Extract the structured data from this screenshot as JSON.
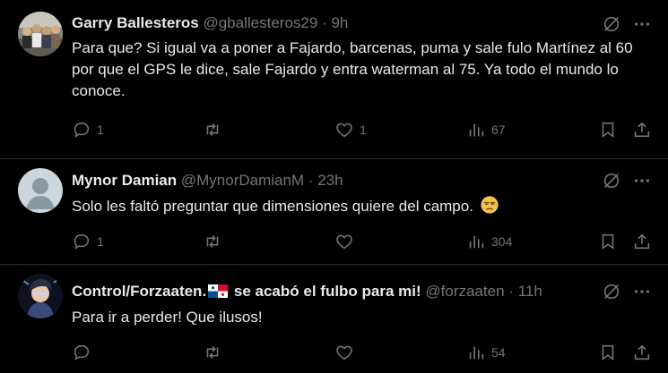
{
  "tweets": [
    {
      "name": "Garry Ballesteros",
      "handle": "@gballesteros29",
      "dot": "·",
      "time": "9h",
      "text": "Para que?  Si igual va a poner a Fajardo, barcenas, puma y sale fulo Martínez al 60 por que el GPS le dice, sale Fajardo y entra waterman al 75. Ya todo el mundo lo conoce.",
      "replies": "1",
      "retweets": "",
      "likes": "1",
      "views": "67",
      "avatar_icon": "group-photo-avatar"
    },
    {
      "name": "Mynor Damian",
      "handle": "@MynorDamianM",
      "dot": "·",
      "time": "23h",
      "text": "Solo les faltó preguntar que dimensiones quiere del campo.",
      "emoji": "unamused-face-emoji",
      "replies": "1",
      "retweets": "",
      "likes": "",
      "views": "304",
      "avatar_icon": "default-profile-avatar"
    },
    {
      "name_part1": "Control/Forzaaten.",
      "flag_icon": "panama-flag-icon",
      "name_part2": " se acabó el fulbo para mi!",
      "handle": "@forzaaten",
      "dot": "·",
      "time": "11h",
      "text": "Para ir a perder! Que ilusos!",
      "replies": "",
      "retweets": "",
      "likes": "",
      "views": "54",
      "avatar_icon": "anime-character-avatar"
    }
  ],
  "colors": {
    "background": "#000000",
    "primary_text": "#e7e9ea",
    "secondary_text": "#71767b",
    "divider": "#2f3336"
  }
}
